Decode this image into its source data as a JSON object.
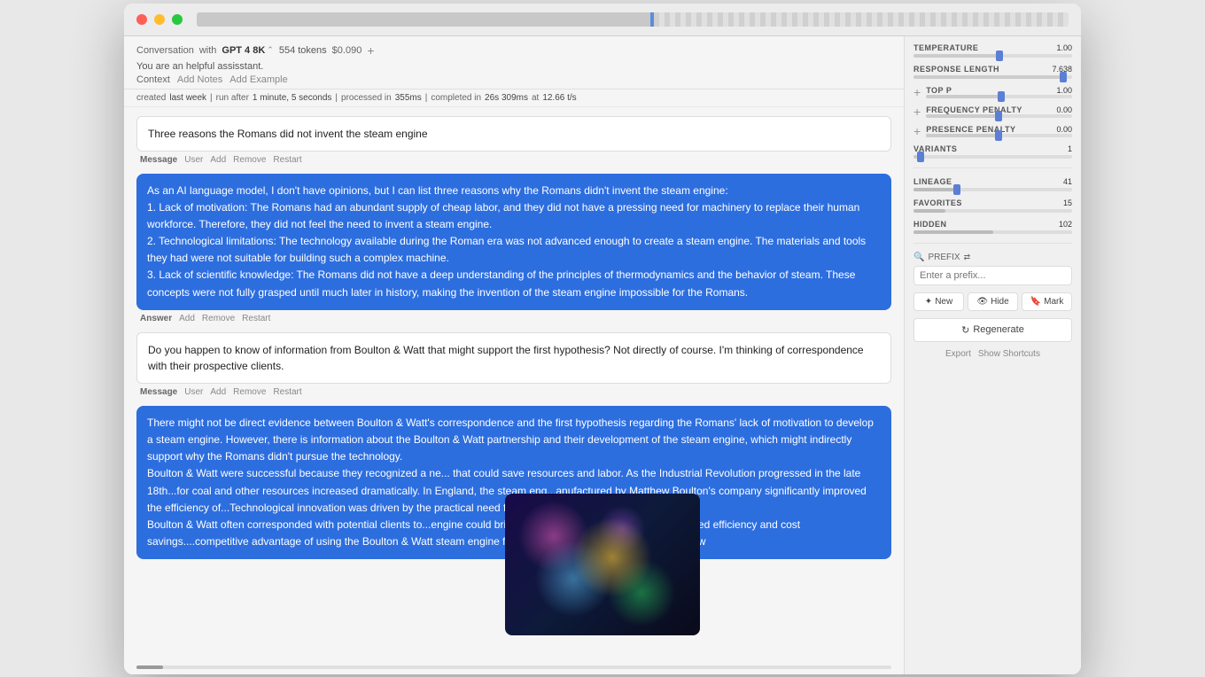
{
  "window": {
    "titlebar": {
      "traffic_lights": [
        "red",
        "yellow",
        "green"
      ]
    }
  },
  "header": {
    "conversation_label": "Conversation",
    "with_label": "with",
    "model": "GPT 4 8K",
    "tokens_label": "554 tokens",
    "cost": "$0.090",
    "add_icon": "+",
    "system_prompt": "You are an helpful assisstant.",
    "context_label": "Context",
    "add_notes": "Add Notes",
    "add_example": "Add Example"
  },
  "timeline": {
    "created_label": "created",
    "created_time": "last week",
    "run_after_label": "run after",
    "run_after_time": "1 minute, 5 seconds",
    "processed_label": "processed in",
    "processed_time": "355ms",
    "completed_label": "completed in",
    "completed_time": "26s 309ms",
    "at_label": "at",
    "speed": "12.66 t/s"
  },
  "messages": [
    {
      "type": "user_input",
      "text": "Three reasons the Romans did not invent the steam engine",
      "role": "Message",
      "user": "User",
      "actions": [
        "Add",
        "Remove",
        "Restart"
      ]
    },
    {
      "type": "answer",
      "text": "As an AI language model, I don't have opinions, but I can list three reasons why the Romans didn't invent the steam engine:\n1. Lack of motivation: The Romans had an abundant supply of cheap labor, and they did not have a pressing need for machinery to replace their human workforce. Therefore, they did not feel the need to invent a steam engine.\n2. Technological limitations: The technology available during the Roman era was not advanced enough to create a steam engine. The materials and tools they had were not suitable for building such a complex machine.\n3. Lack of scientific knowledge: The Romans did not have a deep understanding of the principles of thermodynamics and the behavior of steam. These concepts were not fully grasped until much later in history, making the invention of the steam engine impossible for the Romans.",
      "role": "Answer",
      "actions": [
        "Add",
        "Remove",
        "Restart"
      ]
    },
    {
      "type": "user_input",
      "text": "Do you happen to know of information from Boulton & Watt that might support the first hypothesis? Not directly of course. I'm thinking of correspondence with their prospective clients.",
      "role": "Message",
      "user": "User",
      "actions": [
        "Add",
        "Remove",
        "Restart"
      ]
    },
    {
      "type": "answer",
      "text": "There might not be direct evidence between Boulton & Watt's correspondence and the first hypothesis regarding the Romans' lack of motivation to develop a steam engine. However, there is information about the Boulton & Watt partnership and their development of the steam engine, which might indirectly support why the Romans didn't pursue the technology.\nBoulton & Watt were successful because they recognized a need for efficient machinery that could save resources and labor. As the Industrial Revolution progressed in the late 18th century, the demand for coal and other resources increased dramatically. In England, the steam engines manufactured by Matthew Boulton's company significantly improved the efficiency of mining operations. Technological innovation was driven by the practical need for more efficient ways of working.\nBoulton & Watt often corresponded with potential clients to demonstrate the value a steam engine could bring to various industries, including improved efficiency and cost savings. They highlighted the competitive advantage of using the Boulton & Watt steam engine for powering mills, factories, and other industries, in turn, saw",
      "role": "Answer",
      "actions": [
        "Add",
        "Remove",
        "Restart"
      ]
    }
  ],
  "right_panel": {
    "params": [
      {
        "label": "TEMPERATURE",
        "value": "1.00",
        "fill_pct": 55,
        "thumb_pct": 55,
        "has_plus": false
      },
      {
        "label": "RESPONSE LENGTH",
        "value": "7.638",
        "fill_pct": 95,
        "thumb_pct": 95,
        "has_plus": false
      },
      {
        "label": "TOP P",
        "value": "1.00",
        "fill_pct": 52,
        "thumb_pct": 52,
        "has_plus": true
      },
      {
        "label": "FreQuENcy PENALTY",
        "value": "0.00",
        "fill_pct": 50,
        "thumb_pct": 50,
        "has_plus": true
      },
      {
        "label": "PRESENCE PENALTY",
        "value": "0.00",
        "fill_pct": 50,
        "thumb_pct": 50,
        "has_plus": true
      },
      {
        "label": "VARIANTS",
        "value": "1",
        "fill_pct": 5,
        "thumb_pct": 5,
        "has_plus": false
      }
    ],
    "lineage_label": "LINEAGE",
    "lineage_value": "41",
    "lineage_fill": 28,
    "lineage_thumb": 28,
    "favorites_label": "FAVORITES",
    "favorites_value": "15",
    "favorites_fill": 20,
    "favorites_thumb": 20,
    "hidden_label": "HIDDEN",
    "hidden_value": "102",
    "hidden_fill": 50,
    "hidden_thumb": 50,
    "prefix_label": "PREFIX",
    "prefix_placeholder": "Enter a prefix...",
    "buttons": {
      "new": "New",
      "hide": "Hide",
      "mark": "Mark",
      "regenerate": "Regenerate",
      "export": "Export",
      "shortcuts": "Show Shortcuts"
    }
  }
}
